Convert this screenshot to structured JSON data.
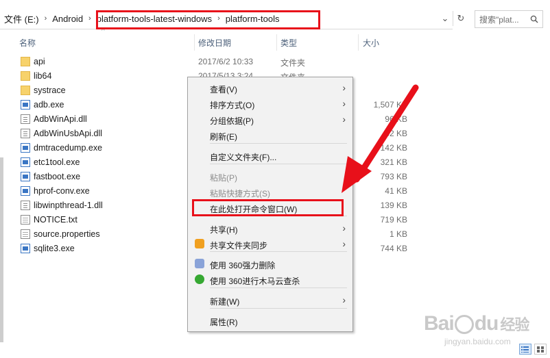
{
  "address": {
    "crumbs": [
      "文件 (E:)",
      "Android",
      "platform-tools-latest-windows",
      "platform-tools"
    ],
    "separator": "›",
    "dropdown_glyph": "⌄",
    "refresh_glyph": "↻",
    "search_placeholder": "搜索\"plat...",
    "search_icon": "search-icon"
  },
  "columns": {
    "name": "名称",
    "date": "修改日期",
    "type": "类型",
    "size": "大小",
    "sort_indicator": "^"
  },
  "files": [
    {
      "name": "api",
      "date": "2017/6/2 10:33",
      "type": "文件夹",
      "size": "",
      "icon": "folder"
    },
    {
      "name": "lib64",
      "date": "2017/5/13 3:24",
      "type": "文件夹",
      "size": "",
      "icon": "folder"
    },
    {
      "name": "systrace",
      "date": "",
      "type": "",
      "size": "",
      "icon": "folder"
    },
    {
      "name": "adb.exe",
      "date": "",
      "type": "",
      "size": "1,507 KB",
      "icon": "exe"
    },
    {
      "name": "AdbWinApi.dll",
      "date": "",
      "type": "",
      "size": "96 KB",
      "icon": "dll"
    },
    {
      "name": "AdbWinUsbApi.dll",
      "date": "",
      "type": "",
      "size": "62 KB",
      "icon": "dll"
    },
    {
      "name": "dmtracedump.exe",
      "date": "",
      "type": "",
      "size": "142 KB",
      "icon": "exe"
    },
    {
      "name": "etc1tool.exe",
      "date": "",
      "type": "",
      "size": "321 KB",
      "icon": "exe"
    },
    {
      "name": "fastboot.exe",
      "date": "",
      "type": "",
      "size": "793 KB",
      "icon": "exe"
    },
    {
      "name": "hprof-conv.exe",
      "date": "",
      "type": "",
      "size": "41 KB",
      "icon": "exe"
    },
    {
      "name": "libwinpthread-1.dll",
      "date": "",
      "type": "",
      "size": "139 KB",
      "icon": "dll"
    },
    {
      "name": "NOTICE.txt",
      "date": "",
      "type": "",
      "size": "719 KB",
      "icon": "txt"
    },
    {
      "name": "source.properties",
      "date": "",
      "type": "",
      "size": "1 KB",
      "icon": "txt"
    },
    {
      "name": "sqlite3.exe",
      "date": "",
      "type": "",
      "size": "744 KB",
      "icon": "exe"
    }
  ],
  "context_menu": {
    "items": [
      {
        "label": "查看(V)",
        "submenu": true,
        "disabled": false
      },
      {
        "label": "排序方式(O)",
        "submenu": true,
        "disabled": false
      },
      {
        "label": "分组依据(P)",
        "submenu": true,
        "disabled": false
      },
      {
        "label": "刷新(E)",
        "submenu": false,
        "disabled": false
      },
      {
        "label": "自定义文件夹(F)...",
        "submenu": false,
        "disabled": false
      },
      {
        "label": "粘贴(P)",
        "submenu": false,
        "disabled": true
      },
      {
        "label": "粘贴快捷方式(S)",
        "submenu": false,
        "disabled": true
      },
      {
        "label": "在此处打开命令窗口(W)",
        "submenu": false,
        "disabled": false
      },
      {
        "label": "共享(H)",
        "submenu": true,
        "disabled": false
      },
      {
        "label": "共享文件夹同步",
        "submenu": true,
        "disabled": false,
        "icon": "sync-share-icon"
      },
      {
        "label": "使用 360强力删除",
        "submenu": false,
        "disabled": false,
        "icon": "shredder-360-icon"
      },
      {
        "label": "使用 360进行木马云查杀",
        "submenu": false,
        "disabled": false,
        "icon": "antivirus-360-icon"
      },
      {
        "label": "新建(W)",
        "submenu": true,
        "disabled": false
      },
      {
        "label": "属性(R)",
        "submenu": false,
        "disabled": false
      }
    ],
    "submenu_glyph": "›"
  },
  "colors": {
    "highlight": "#e8101a",
    "folder": "#f7d26b",
    "exe": "#3a76c4"
  },
  "watermark": {
    "logo": "Bai",
    "logo_suffix": "du",
    "logo_cn": "经验",
    "url": "jingyan.baidu.com"
  }
}
